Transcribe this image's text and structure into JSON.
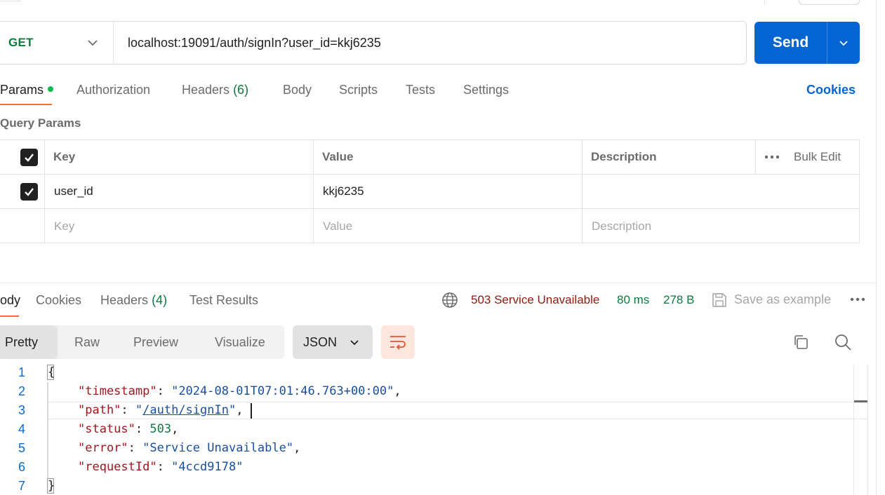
{
  "request": {
    "method": "GET",
    "url": "localhost:19091/auth/signIn?user_id=kkj6235",
    "send_label": "Send"
  },
  "request_tabs": [
    {
      "label": "Params",
      "active": true
    },
    {
      "label": "Authorization"
    },
    {
      "label": "Headers",
      "count": "(6)"
    },
    {
      "label": "Body"
    },
    {
      "label": "Scripts"
    },
    {
      "label": "Tests"
    },
    {
      "label": "Settings"
    }
  ],
  "cookies_link": "Cookies",
  "query_params": {
    "title": "Query Params",
    "headers": {
      "key": "Key",
      "value": "Value",
      "description": "Description",
      "bulk_edit": "Bulk Edit"
    },
    "rows": [
      {
        "key": "user_id",
        "value": "kkj6235",
        "description": "",
        "checked": true
      }
    ],
    "placeholders": {
      "key": "Key",
      "value": "Value",
      "description": "Description"
    }
  },
  "response_tabs": [
    {
      "label": "ody",
      "active": true
    },
    {
      "label": "Cookies"
    },
    {
      "label": "Headers",
      "count": "(4)"
    },
    {
      "label": "Test Results"
    }
  ],
  "response_meta": {
    "status": "503 Service Unavailable",
    "time": "80 ms",
    "size": "278 B",
    "save_label": "Save as example"
  },
  "view_modes": [
    "Pretty",
    "Raw",
    "Preview",
    "Visualize"
  ],
  "format": "JSON",
  "code": {
    "line_numbers": [
      "1",
      "2",
      "3",
      "4",
      "5",
      "6",
      "7"
    ],
    "open_brace": "{",
    "close_brace": "}",
    "fields": [
      {
        "key": "\"timestamp\"",
        "value": "\"2024-08-01T07:01:46.763+00:00\"",
        "type": "string"
      },
      {
        "key": "\"path\"",
        "value": "\"/auth/signIn\"",
        "type": "link"
      },
      {
        "key": "\"status\"",
        "value": "503",
        "type": "number"
      },
      {
        "key": "\"error\"",
        "value": "\"Service Unavailable\"",
        "type": "string"
      },
      {
        "key": "\"requestId\"",
        "value": "\"4ccd9178\"",
        "type": "string",
        "last": true
      }
    ]
  },
  "colors": {
    "accent": "#0265d2",
    "tab_indicator": "#ff6c37",
    "status_error": "#8e1a10",
    "success": "#0b7a3e"
  },
  "icons": [
    "chevron-down-icon",
    "globe-icon",
    "save-icon",
    "more-icon",
    "copy-icon",
    "search-icon",
    "wrap-lines-icon",
    "checkbox-checked-icon"
  ]
}
